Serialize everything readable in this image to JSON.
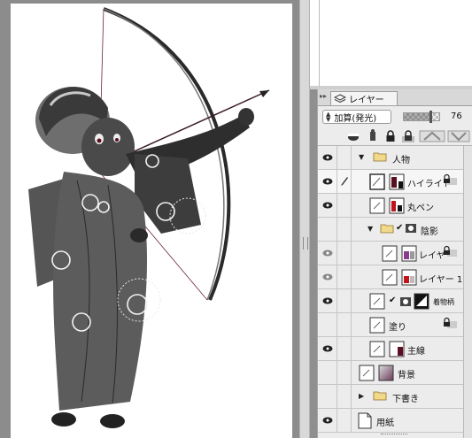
{
  "layer_panel": {
    "tab_label": "レイヤー",
    "blend_mode": "加算(発光)",
    "opacity": "76",
    "opacity_fraction": 0.76
  },
  "layers": {
    "folder_person": "人物",
    "highlight": "ハイライト",
    "round_pen": "丸ペン",
    "folder_shadow": "陰影",
    "layer_a": "レイヤ",
    "layer_1": "レイヤー 1",
    "kimono_pattern": "着物柄",
    "fill": "塗り",
    "main_line": "主線",
    "background": "背景",
    "folder_draft": "下書き",
    "paper": "用紙"
  },
  "icons": {
    "tab": "layers-icon",
    "eye": "eye-icon",
    "pen": "pen-edit-icon",
    "folder": "folder-icon",
    "lock": "lock-icon",
    "mask": "layer-mask-icon"
  },
  "colors": {
    "canvas_bg": "#8c8c8c",
    "paper": "#ffffff",
    "panel_bg": "#ececec",
    "folder_yellow": "#f2d98a",
    "thumb_purple": "#8a3a8a",
    "thumb_red": "#c0141c",
    "thumb_maroon": "#5a1020"
  }
}
